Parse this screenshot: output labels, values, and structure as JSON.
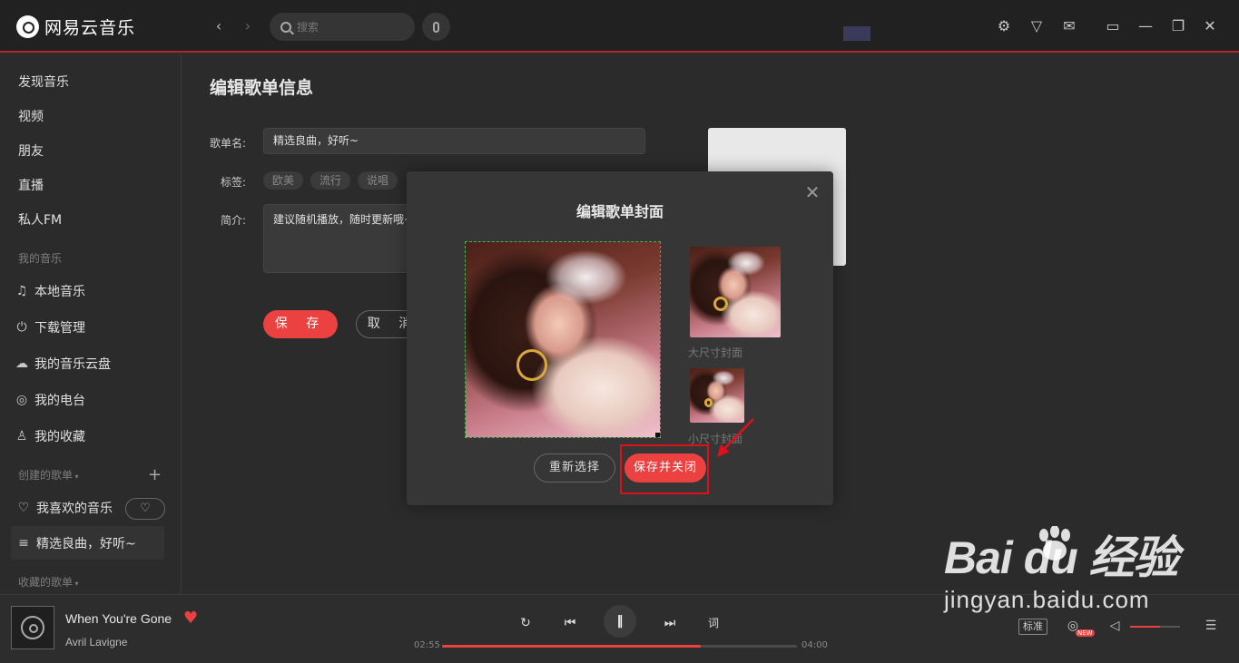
{
  "app": {
    "name": "网易云音乐"
  },
  "search": {
    "placeholder": "搜索"
  },
  "sidebar": {
    "items": [
      {
        "label": "发现音乐"
      },
      {
        "label": "视频"
      },
      {
        "label": "朋友"
      },
      {
        "label": "直播"
      },
      {
        "label": "私人FM"
      }
    ],
    "my_music_header": "我的音乐",
    "my_music": [
      {
        "label": "本地音乐",
        "icon": "music-note-icon"
      },
      {
        "label": "下载管理",
        "icon": "download-icon"
      },
      {
        "label": "我的音乐云盘",
        "icon": "cloud-icon"
      },
      {
        "label": "我的电台",
        "icon": "radio-icon"
      },
      {
        "label": "我的收藏",
        "icon": "collection-icon"
      }
    ],
    "created_header": "创建的歌单",
    "created": [
      {
        "label": "我喜欢的音乐",
        "icon": "heart-icon"
      },
      {
        "label": "精选良曲，好听~",
        "icon": "playlist-icon"
      }
    ],
    "collected_header": "收藏的歌单"
  },
  "main": {
    "title": "编辑歌单信息",
    "name_label": "歌单名:",
    "name_value": "精选良曲，好听~",
    "tags_label": "标签:",
    "tags": [
      "欧美",
      "流行",
      "说唱"
    ],
    "intro_label": "简介:",
    "intro_value": "建议随机播放，随时更新哦~",
    "save_label": "保 存",
    "cancel_label": "取 消"
  },
  "modal": {
    "title": "编辑歌单封面",
    "large_label": "大尺寸封面",
    "small_label": "小尺寸封面",
    "reselect_label": "重新选择",
    "save_close_label": "保存并关闭"
  },
  "player": {
    "song": "When You're Gone",
    "artist": "Avril Lavigne",
    "current_time": "02:55",
    "total_time": "04:00",
    "progress": 0.73,
    "lyrics_label": "词",
    "quality_label": "标准",
    "new_badge": "NEW",
    "volume": 0.6
  },
  "watermark": {
    "main": "Bai du 经验",
    "sub": "jingyan.baidu.com"
  },
  "colors": {
    "accent": "#ec4141",
    "topbar": "#212121",
    "background": "#2b2b2b",
    "highlight": "#e0101a"
  }
}
